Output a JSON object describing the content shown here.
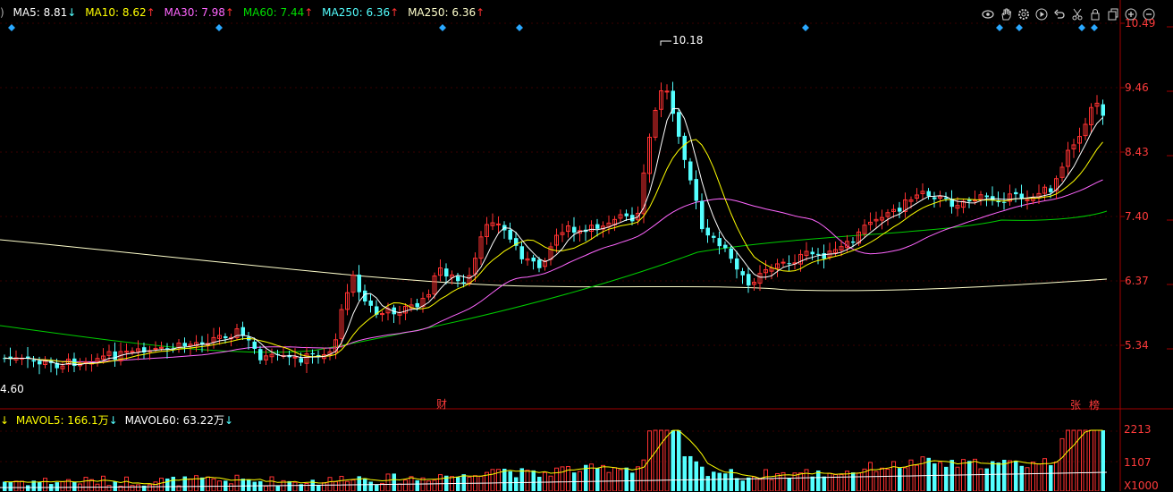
{
  "legend": {
    "ma5": "MA5: 8.81",
    "ma5_arrow": "↓",
    "ma10": "MA10: 8.62",
    "ma10_arrow": "↑",
    "ma30": "MA30: 7.98",
    "ma30_arrow": "↑",
    "ma60": "MA60: 7.44",
    "ma60_arrow": "↑",
    "ma250a": "MA250: 6.36",
    "ma250a_arrow": "↑",
    "ma250b": "MA250: 6.36",
    "ma250b_arrow": "↑"
  },
  "vol_legend": {
    "mavol5": "MAVOL5: 166.1万",
    "mavol5_arrow": "↓",
    "mavol60": "MAVOL60: 63.22万",
    "mavol60_arrow": "↓"
  },
  "price_axis": [
    "10.49",
    "9.46",
    "8.43",
    "7.40",
    "6.37",
    "5.34"
  ],
  "volume_axis": [
    "2213",
    "1107",
    "X1000"
  ],
  "annotations": {
    "high": "10.18",
    "low": "4.60"
  },
  "event_markers": {
    "cai": "财",
    "zhang": "张",
    "bang": "榜"
  },
  "colors": {
    "up": "#ff3232",
    "down": "#54ffff",
    "ma5": "#ffffff",
    "ma10": "#ffff00",
    "ma30": "#ff66ff",
    "ma60": "#00cc00",
    "ma250": "#ffffcc",
    "axis": "#ff3b3b"
  },
  "toolbar_icons": [
    "eye-icon",
    "hand-icon",
    "gear-icon",
    "play-icon",
    "undo-icon",
    "scissors-icon",
    "lock-icon",
    "copy-icon",
    "zoom-in-icon",
    "zoom-out-icon"
  ]
}
